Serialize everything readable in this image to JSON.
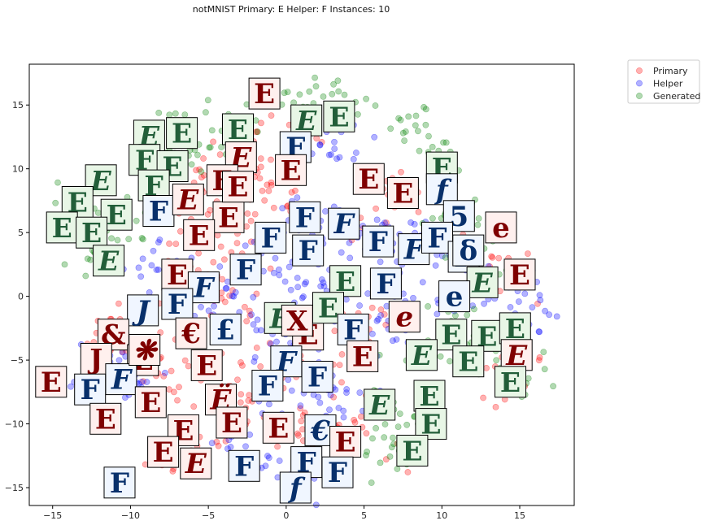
{
  "chart_data": {
    "type": "scatter",
    "title": "notMNIST Primary: E Helper: F Instances: 10",
    "xlabel": "",
    "ylabel": "",
    "xlim": [
      -16.5,
      18.5
    ],
    "ylim": [
      -16.4,
      18.2
    ],
    "xticks": [
      -15,
      -10,
      -5,
      0,
      5,
      10,
      15
    ],
    "yticks": [
      -15,
      -10,
      -5,
      0,
      5,
      10,
      15
    ],
    "grid": false,
    "legend_position": "outside-top-right",
    "series": [
      {
        "name": "Primary",
        "color": "#ff0000",
        "centers": [
          [
            -5,
            8
          ],
          [
            -3,
            10
          ],
          [
            -2,
            5
          ],
          [
            -6,
            3
          ],
          [
            -4,
            -1
          ],
          [
            -2,
            -6
          ],
          [
            -4,
            -9
          ],
          [
            -6,
            -12
          ],
          [
            1,
            -10
          ],
          [
            4,
            -11
          ],
          [
            -8,
            -6
          ],
          [
            -11,
            -3
          ],
          [
            3,
            -4
          ],
          [
            5,
            -2
          ],
          [
            14,
            -5
          ],
          [
            13,
            3
          ],
          [
            7,
            7
          ],
          [
            1,
            13
          ],
          [
            -1,
            9
          ]
        ],
        "spread": 1.4,
        "counts": 20
      },
      {
        "name": "Helper",
        "color": "#0000ff",
        "centers": [
          [
            1,
            5
          ],
          [
            4,
            4
          ],
          [
            7,
            4
          ],
          [
            10,
            4
          ],
          [
            6,
            0
          ],
          [
            8,
            -2
          ],
          [
            2,
            -1
          ],
          [
            -1,
            -3
          ],
          [
            0,
            -7
          ],
          [
            3,
            -8
          ],
          [
            -3,
            -13
          ],
          [
            1,
            -14
          ],
          [
            -10,
            -6
          ],
          [
            -12,
            -5
          ],
          [
            -8,
            2
          ],
          [
            -5,
            0
          ],
          [
            13,
            1
          ],
          [
            15,
            -1
          ],
          [
            3,
            12
          ],
          [
            -1,
            2
          ]
        ],
        "spread": 1.3,
        "counts": 20
      },
      {
        "name": "Generated",
        "color": "#008000",
        "centers": [
          [
            -13,
            7
          ],
          [
            -10,
            6
          ],
          [
            -8,
            11
          ],
          [
            -5,
            12
          ],
          [
            -3,
            14
          ],
          [
            1,
            15
          ],
          [
            4,
            15
          ],
          [
            8,
            13
          ],
          [
            10,
            11
          ],
          [
            11,
            7
          ],
          [
            12,
            3
          ],
          [
            11,
            -2
          ],
          [
            13,
            -4
          ],
          [
            15,
            -6
          ],
          [
            9,
            -5
          ],
          [
            6,
            -8
          ],
          [
            8,
            -11
          ],
          [
            6,
            -12
          ],
          [
            -12,
            3
          ],
          [
            -7,
            13
          ]
        ],
        "spread": 1.0,
        "counts": 14
      }
    ],
    "thumbnails": [
      {
        "x": -1.4,
        "y": 15.9,
        "ch": "E",
        "kind": "primary"
      },
      {
        "x": 1.3,
        "y": 13.8,
        "ch": "E",
        "kind": "generated"
      },
      {
        "x": 3.4,
        "y": 14.1,
        "ch": "E",
        "kind": "generated"
      },
      {
        "x": 0.6,
        "y": 11.7,
        "ch": "F",
        "kind": "helper"
      },
      {
        "x": -3.1,
        "y": 13.1,
        "ch": "E",
        "kind": "generated"
      },
      {
        "x": -2.9,
        "y": 10.9,
        "ch": "E",
        "kind": "primary"
      },
      {
        "x": 0.3,
        "y": 9.9,
        "ch": "E",
        "kind": "primary"
      },
      {
        "x": -4.1,
        "y": 9.1,
        "ch": "E",
        "kind": "primary"
      },
      {
        "x": -6.7,
        "y": 12.8,
        "ch": "E",
        "kind": "generated"
      },
      {
        "x": -8.8,
        "y": 12.6,
        "ch": "E",
        "kind": "generated"
      },
      {
        "x": -9.1,
        "y": 10.7,
        "ch": "F",
        "kind": "generated"
      },
      {
        "x": -7.3,
        "y": 10.2,
        "ch": "E",
        "kind": "generated"
      },
      {
        "x": -8.5,
        "y": 8.7,
        "ch": "F",
        "kind": "generated"
      },
      {
        "x": -11.9,
        "y": 9.1,
        "ch": "E",
        "kind": "generated"
      },
      {
        "x": -13.4,
        "y": 7.4,
        "ch": "E",
        "kind": "generated"
      },
      {
        "x": -10.9,
        "y": 6.4,
        "ch": "E",
        "kind": "generated"
      },
      {
        "x": -8.2,
        "y": 6.7,
        "ch": "F",
        "kind": "helper"
      },
      {
        "x": -6.3,
        "y": 7.6,
        "ch": "E",
        "kind": "primary"
      },
      {
        "x": -3.7,
        "y": 6.2,
        "ch": "E",
        "kind": "primary"
      },
      {
        "x": -14.4,
        "y": 5.4,
        "ch": "E",
        "kind": "generated"
      },
      {
        "x": -12.5,
        "y": 5.0,
        "ch": "E",
        "kind": "generated"
      },
      {
        "x": -11.4,
        "y": 2.8,
        "ch": "E",
        "kind": "generated"
      },
      {
        "x": -5.6,
        "y": 4.8,
        "ch": "E",
        "kind": "primary"
      },
      {
        "x": -1.0,
        "y": 4.6,
        "ch": "F",
        "kind": "helper"
      },
      {
        "x": 1.2,
        "y": 6.2,
        "ch": "F",
        "kind": "helper"
      },
      {
        "x": 3.7,
        "y": 5.7,
        "ch": "F",
        "kind": "helper"
      },
      {
        "x": 5.3,
        "y": 9.2,
        "ch": "E",
        "kind": "primary"
      },
      {
        "x": 7.5,
        "y": 8.1,
        "ch": "E",
        "kind": "primary"
      },
      {
        "x": 10.0,
        "y": 10.1,
        "ch": "E",
        "kind": "generated"
      },
      {
        "x": 10.0,
        "y": 8.4,
        "ch": "f",
        "kind": "helper"
      },
      {
        "x": 11.1,
        "y": 6.3,
        "ch": "5",
        "kind": "helper"
      },
      {
        "x": 13.8,
        "y": 5.4,
        "ch": "e",
        "kind": "primary"
      },
      {
        "x": 5.9,
        "y": 4.3,
        "ch": "F",
        "kind": "helper"
      },
      {
        "x": 8.2,
        "y": 3.7,
        "ch": "F",
        "kind": "helper"
      },
      {
        "x": 9.7,
        "y": 4.6,
        "ch": "F",
        "kind": "helper"
      },
      {
        "x": 11.4,
        "y": 3.1,
        "ch": "F",
        "kind": "helper"
      },
      {
        "x": 15.0,
        "y": 1.7,
        "ch": "E",
        "kind": "primary"
      },
      {
        "x": 12.6,
        "y": 1.1,
        "ch": "E",
        "kind": "generated"
      },
      {
        "x": 1.4,
        "y": 3.6,
        "ch": "F",
        "kind": "helper"
      },
      {
        "x": -2.6,
        "y": 2.1,
        "ch": "F",
        "kind": "helper"
      },
      {
        "x": -7.0,
        "y": 1.7,
        "ch": "E",
        "kind": "primary"
      },
      {
        "x": -5.3,
        "y": 0.7,
        "ch": "F",
        "kind": "helper"
      },
      {
        "x": 3.8,
        "y": 1.2,
        "ch": "E",
        "kind": "generated"
      },
      {
        "x": 6.4,
        "y": 1.0,
        "ch": "F",
        "kind": "helper"
      },
      {
        "x": 10.8,
        "y": 0.0,
        "ch": "e",
        "kind": "helper"
      },
      {
        "x": -9.2,
        "y": -1.1,
        "ch": "J",
        "kind": "helper"
      },
      {
        "x": -7.0,
        "y": -0.6,
        "ch": "F",
        "kind": "helper"
      },
      {
        "x": -6.1,
        "y": -2.9,
        "ch": "€",
        "kind": "primary"
      },
      {
        "x": -3.9,
        "y": -2.6,
        "ch": "£",
        "kind": "helper"
      },
      {
        "x": -0.4,
        "y": -1.7,
        "ch": "E",
        "kind": "generated"
      },
      {
        "x": 1.4,
        "y": -3.0,
        "ch": "E",
        "kind": "primary"
      },
      {
        "x": 2.7,
        "y": -0.9,
        "ch": "E",
        "kind": "generated"
      },
      {
        "x": 4.3,
        "y": -2.6,
        "ch": "F",
        "kind": "helper"
      },
      {
        "x": 7.6,
        "y": -1.6,
        "ch": "e",
        "kind": "primary"
      },
      {
        "x": 10.6,
        "y": -3.0,
        "ch": "E",
        "kind": "generated"
      },
      {
        "x": 12.9,
        "y": -3.1,
        "ch": "E",
        "kind": "generated"
      },
      {
        "x": 14.7,
        "y": -2.5,
        "ch": "E",
        "kind": "generated"
      },
      {
        "x": 14.8,
        "y": -4.6,
        "ch": "E",
        "kind": "primary"
      },
      {
        "x": -11.1,
        "y": -3.0,
        "ch": "&",
        "kind": "primary"
      },
      {
        "x": -12.2,
        "y": -4.9,
        "ch": "J",
        "kind": "primary"
      },
      {
        "x": -9.2,
        "y": -5.0,
        "ch": "E",
        "kind": "primary"
      },
      {
        "x": -10.6,
        "y": -6.5,
        "ch": "F",
        "kind": "helper"
      },
      {
        "x": -12.6,
        "y": -7.3,
        "ch": "F",
        "kind": "helper"
      },
      {
        "x": -15.1,
        "y": -6.7,
        "ch": "E",
        "kind": "primary"
      },
      {
        "x": -5.1,
        "y": -5.4,
        "ch": "E",
        "kind": "primary"
      },
      {
        "x": 0.0,
        "y": -5.1,
        "ch": "F",
        "kind": "helper"
      },
      {
        "x": 2.0,
        "y": -6.3,
        "ch": "F",
        "kind": "helper"
      },
      {
        "x": -1.2,
        "y": -7.0,
        "ch": "F",
        "kind": "helper"
      },
      {
        "x": 4.9,
        "y": -4.7,
        "ch": "E",
        "kind": "primary"
      },
      {
        "x": 8.7,
        "y": -4.6,
        "ch": "E",
        "kind": "generated"
      },
      {
        "x": 11.7,
        "y": -5.1,
        "ch": "E",
        "kind": "generated"
      },
      {
        "x": 14.4,
        "y": -6.7,
        "ch": "E",
        "kind": "generated"
      },
      {
        "x": -8.7,
        "y": -8.3,
        "ch": "E",
        "kind": "primary"
      },
      {
        "x": -4.2,
        "y": -8.1,
        "ch": "Ë",
        "kind": "primary"
      },
      {
        "x": -3.5,
        "y": -9.9,
        "ch": "E",
        "kind": "primary"
      },
      {
        "x": -11.6,
        "y": -9.6,
        "ch": "E",
        "kind": "primary"
      },
      {
        "x": -6.6,
        "y": -10.5,
        "ch": "E",
        "kind": "primary"
      },
      {
        "x": 6.0,
        "y": -8.5,
        "ch": "E",
        "kind": "generated"
      },
      {
        "x": 9.2,
        "y": -7.8,
        "ch": "E",
        "kind": "generated"
      },
      {
        "x": 9.3,
        "y": -10.0,
        "ch": "E",
        "kind": "generated"
      },
      {
        "x": -0.5,
        "y": -10.3,
        "ch": "E",
        "kind": "primary"
      },
      {
        "x": 2.2,
        "y": -10.5,
        "ch": "€",
        "kind": "helper"
      },
      {
        "x": 3.8,
        "y": -11.4,
        "ch": "E",
        "kind": "primary"
      },
      {
        "x": 8.1,
        "y": -12.1,
        "ch": "E",
        "kind": "generated"
      },
      {
        "x": -7.9,
        "y": -12.2,
        "ch": "E",
        "kind": "primary"
      },
      {
        "x": -5.8,
        "y": -13.1,
        "ch": "E",
        "kind": "primary"
      },
      {
        "x": -2.7,
        "y": -13.3,
        "ch": "F",
        "kind": "helper"
      },
      {
        "x": 1.3,
        "y": -13.0,
        "ch": "F",
        "kind": "helper"
      },
      {
        "x": 3.3,
        "y": -13.8,
        "ch": "F",
        "kind": "helper"
      },
      {
        "x": 0.6,
        "y": -15.0,
        "ch": "f",
        "kind": "helper"
      },
      {
        "x": -10.7,
        "y": -14.6,
        "ch": "F",
        "kind": "helper"
      },
      {
        "x": -3.1,
        "y": 8.6,
        "ch": "E",
        "kind": "primary"
      },
      {
        "x": 0.7,
        "y": -1.9,
        "ch": "X",
        "kind": "primary"
      },
      {
        "x": -9.1,
        "y": -4.2,
        "ch": "❋",
        "kind": "primary"
      },
      {
        "x": 11.7,
        "y": 3.6,
        "ch": "δ",
        "kind": "helper"
      }
    ]
  },
  "legend": {
    "items": [
      {
        "label": "Primary",
        "color": "#ff0000"
      },
      {
        "label": "Helper",
        "color": "#0000ff"
      },
      {
        "label": "Generated",
        "color": "#008000"
      }
    ]
  },
  "palette": {
    "primary_fill": "#fff0ee",
    "primary_ink": "#7f0000",
    "helper_fill": "#f0f6ff",
    "helper_ink": "#08306b",
    "generated_fill": "#e8f6e6",
    "generated_ink": "#00441b"
  }
}
